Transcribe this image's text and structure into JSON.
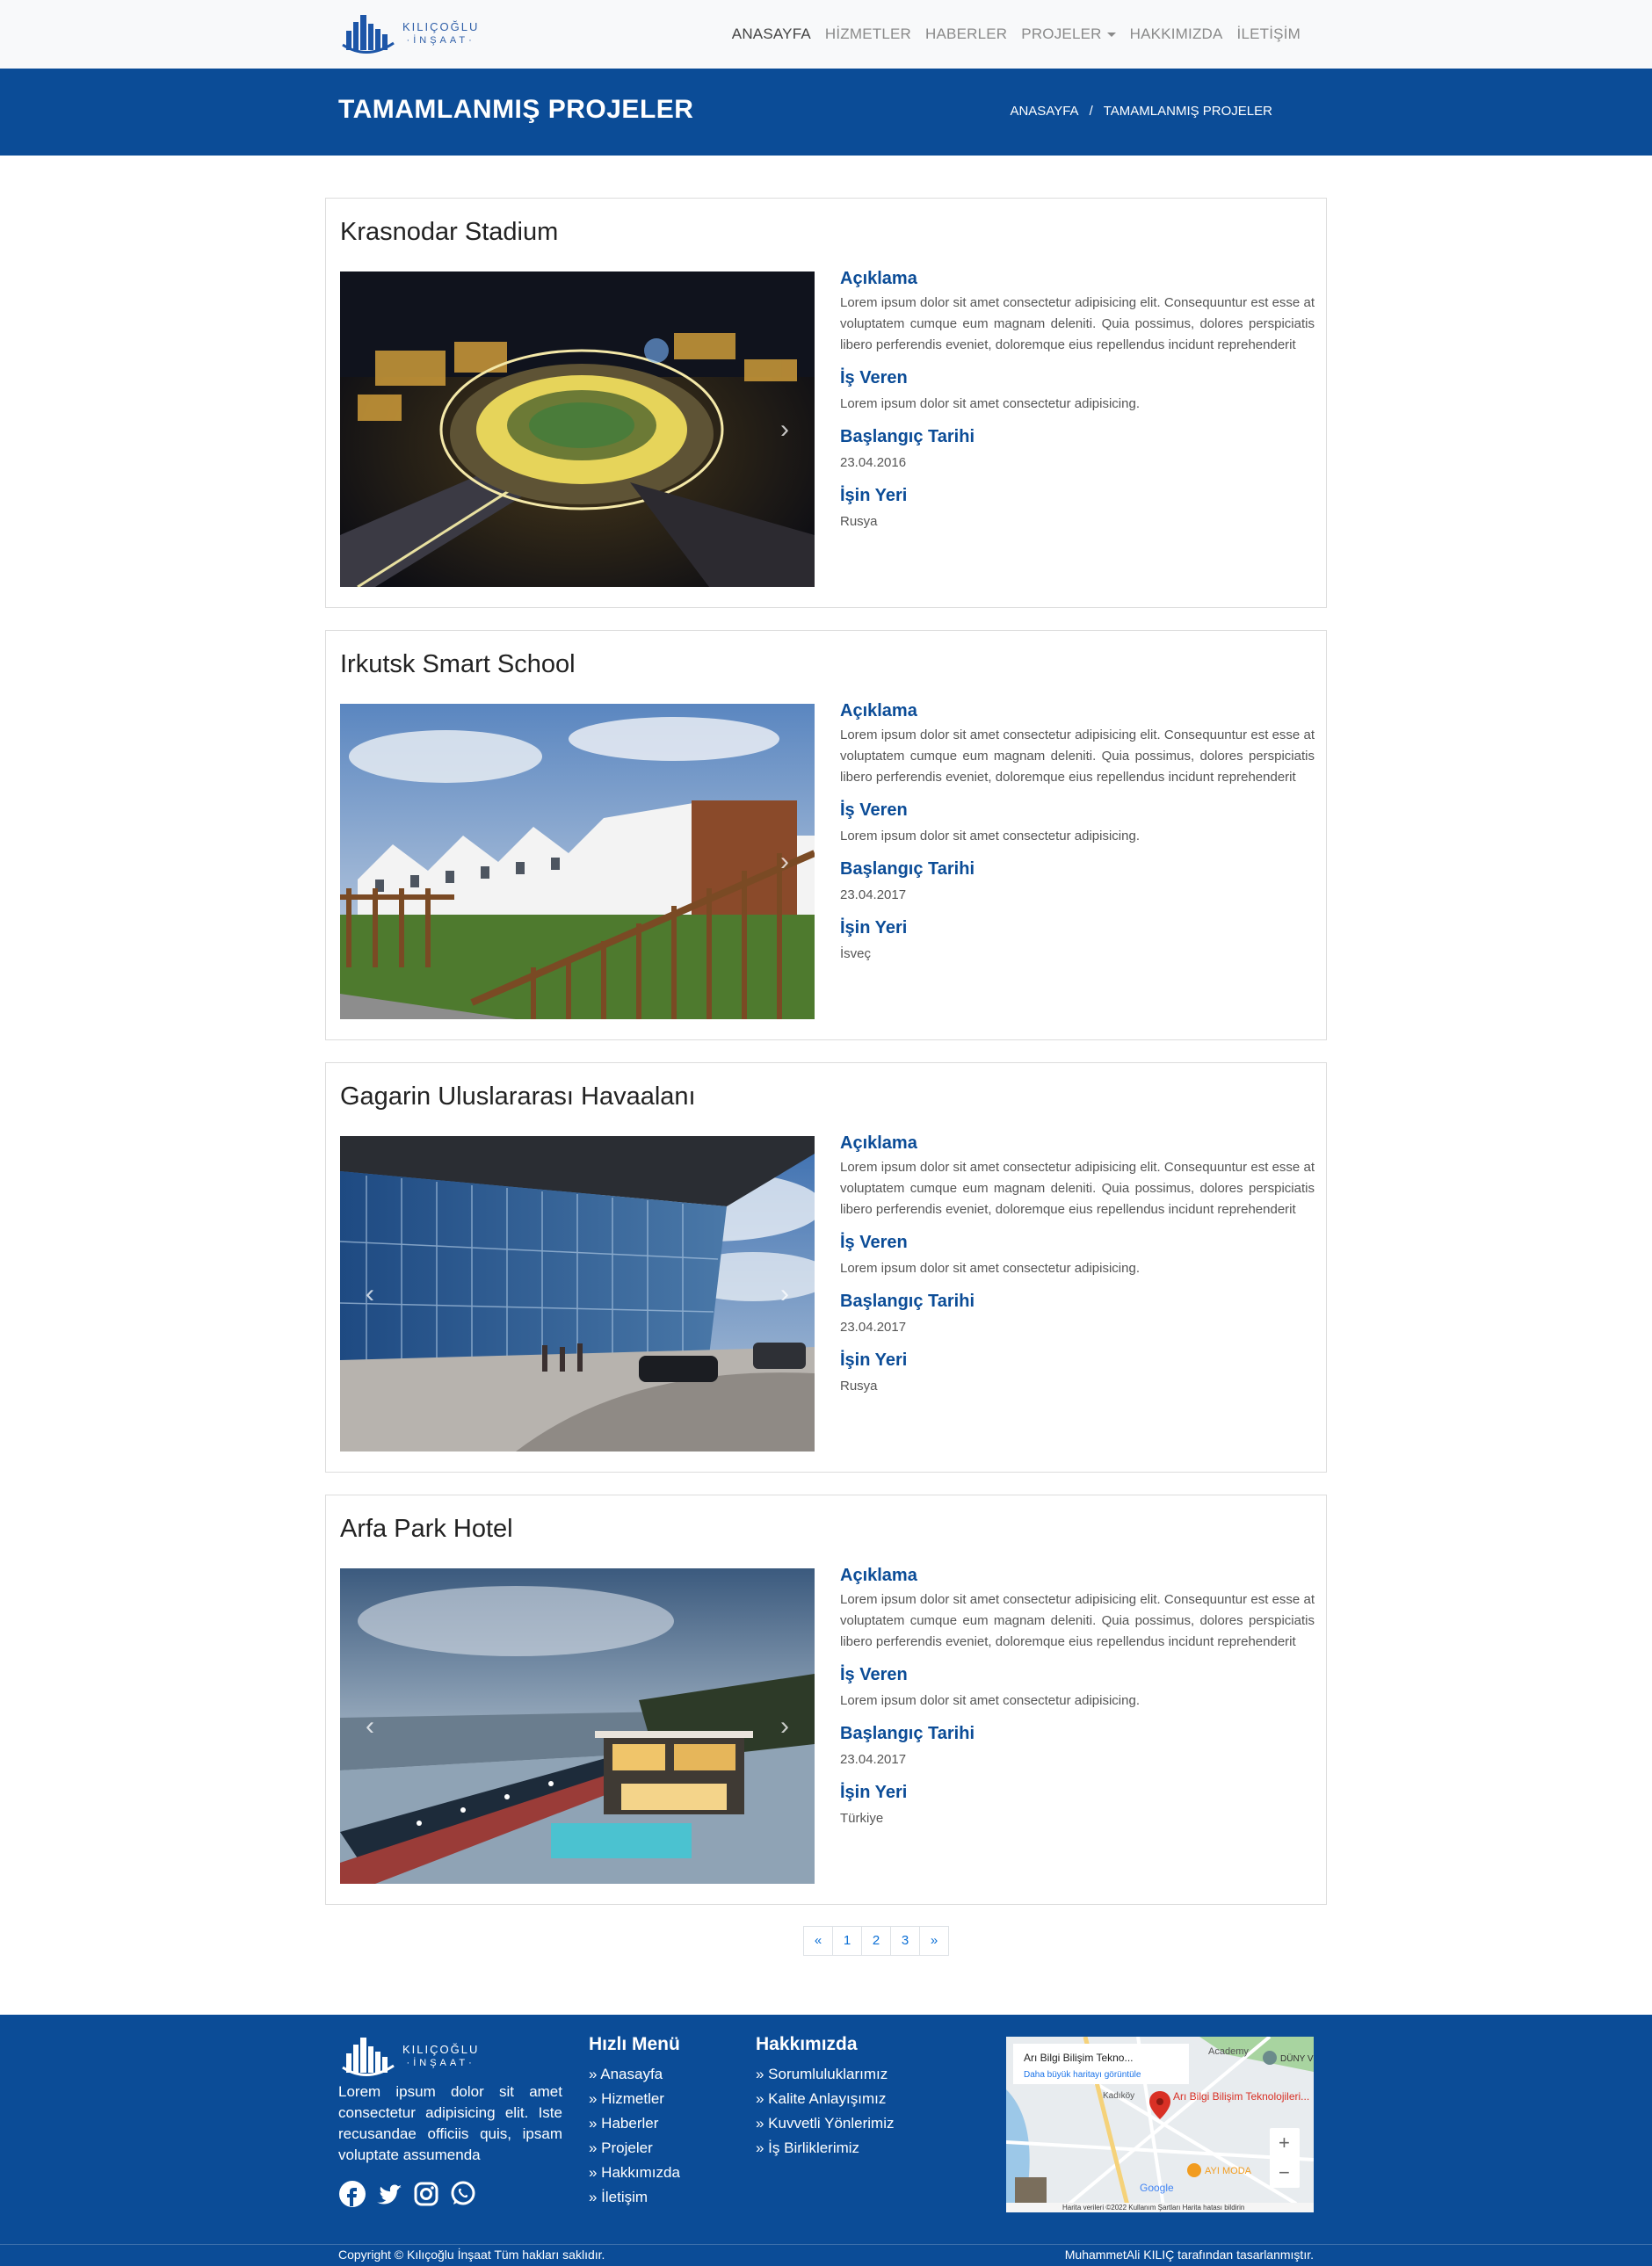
{
  "brand": {
    "line1": "KILIÇOĞLU",
    "line2": "·İNŞAAT·"
  },
  "nav": [
    {
      "label": "ANASAYFA"
    },
    {
      "label": "HİZMETLER"
    },
    {
      "label": "HABERLER"
    },
    {
      "label": "PROJELER"
    },
    {
      "label": "HAKKIMIZDA"
    },
    {
      "label": "İLETİŞİM"
    }
  ],
  "header": {
    "title": "TAMAMLANMIŞ PROJELER",
    "breadcrumb_home": "ANASAYFA",
    "breadcrumb_sep": "/",
    "breadcrumb_current": "TAMAMLANMIŞ PROJELER"
  },
  "labels": {
    "aciklama": "Açıklama",
    "is_veren": "İş Veren",
    "baslangic": "Başlangıç Tarihi",
    "isin_yeri": "İşin Yeri"
  },
  "projects": [
    {
      "title": "Krasnodar Stadium",
      "description": "Lorem ipsum dolor sit amet consectetur adipisicing elit. Consequuntur est esse at voluptatem cumque eum magnam deleniti. Quia possimus, dolores perspiciatis libero perferendis eveniet, doloremque eius repellendus incidunt reprehenderit",
      "employer": "Lorem ipsum dolor sit amet consectetur adipisicing.",
      "date": "23.04.2016",
      "location": "Rusya"
    },
    {
      "title": "Irkutsk Smart School",
      "description": "Lorem ipsum dolor sit amet consectetur adipisicing elit. Consequuntur est esse at voluptatem cumque eum magnam deleniti. Quia possimus, dolores perspiciatis libero perferendis eveniet, doloremque eius repellendus incidunt reprehenderit",
      "employer": "Lorem ipsum dolor sit amet consectetur adipisicing.",
      "date": "23.04.2017",
      "location": "İsveç"
    },
    {
      "title": "Gagarin Uluslararası Havaalanı",
      "description": "Lorem ipsum dolor sit amet consectetur adipisicing elit. Consequuntur est esse at voluptatem cumque eum magnam deleniti. Quia possimus, dolores perspiciatis libero perferendis eveniet, doloremque eius repellendus incidunt reprehenderit",
      "employer": "Lorem ipsum dolor sit amet consectetur adipisicing.",
      "date": "23.04.2017",
      "location": "Rusya"
    },
    {
      "title": "Arfa Park Hotel",
      "description": "Lorem ipsum dolor sit amet consectetur adipisicing elit. Consequuntur est esse at voluptatem cumque eum magnam deleniti. Quia possimus, dolores perspiciatis libero perferendis eveniet, doloremque eius repellendus incidunt reprehenderit",
      "employer": "Lorem ipsum dolor sit amet consectetur adipisicing.",
      "date": "23.04.2017",
      "location": "Türkiye"
    }
  ],
  "pagination": [
    "«",
    "1",
    "2",
    "3",
    "»"
  ],
  "footer": {
    "description": "Lorem ipsum dolor sit amet consectetur adipisicing elit. Iste recusandae officiis quis, ipsam voluptate assumenda",
    "quick_menu_title": "Hızlı Menü",
    "quick_menu": [
      "» Anasayfa",
      "» Hizmetler",
      "» Haberler",
      "» Projeler",
      "» Hakkımızda",
      "» İletişim"
    ],
    "about_title": "Hakkımızda",
    "about_links": [
      "» Sorumluluklarımız",
      "» Kalite Anlayışımız",
      "» Kuvvetli Yönlerimiz",
      "» İş Birliklerimiz"
    ],
    "map": {
      "place": "Arı Bilgi Bilişim Tekno...",
      "link": "Daha büyük haritayı görüntüle",
      "pin_label": "Arı Bilgi Bilişim Teknolojileri...",
      "poi1": "AYI MODA",
      "poi2": "Kadıköy",
      "poi3": "DÜNY VE MI",
      "poi4": "Academy",
      "footer_text": "Harita verileri ©2022   Kullanım Şartları   Harita hatası bildirin",
      "google": "Google"
    },
    "copyright": "Copyright © Kılıçoğlu İnşaat Tüm hakları saklıdır.",
    "designer": "MuhammetAli KILIÇ tarafından tasarlanmıştır."
  },
  "colors": {
    "primary": "#0b4c97",
    "navbar_bg": "#f8f9fa"
  }
}
